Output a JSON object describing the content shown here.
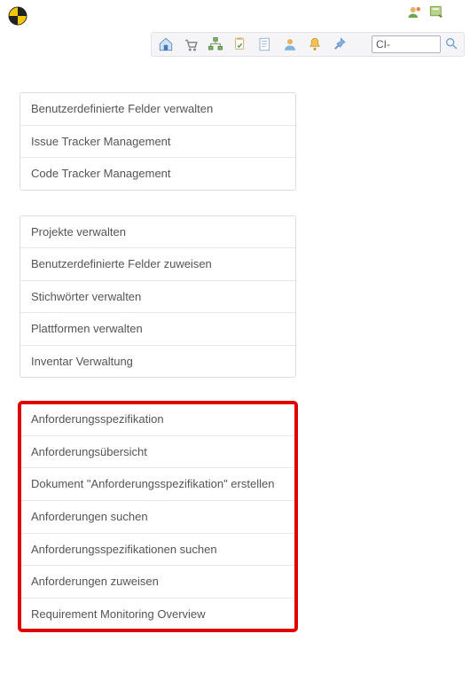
{
  "toolbar": {
    "search_value": "CI-",
    "icons": {
      "home": "home-icon",
      "cart": "cart-icon",
      "tree": "tree-icon",
      "plan": "plan-icon",
      "report": "report-icon",
      "user": "user-icon",
      "bell": "bell-icon",
      "pin": "pin-icon",
      "search": "search-icon"
    },
    "header_icons": {
      "users": "users-icon",
      "window": "window-icon"
    }
  },
  "panel_admin": {
    "items": [
      "Benutzerdefinierte Felder verwalten",
      "Issue Tracker Management",
      "Code Tracker Management"
    ]
  },
  "panel_project": {
    "items": [
      "Projekte verwalten",
      "Benutzerdefinierte Felder zuweisen",
      "Stichwörter verwalten",
      "Plattformen verwalten",
      "Inventar Verwaltung"
    ]
  },
  "panel_requirements": {
    "items": [
      "Anforderungsspezifikation",
      "Anforderungsübersicht",
      "Dokument \"Anforderungsspezifikation\" erstellen",
      "Anforderungen suchen",
      "Anforderungsspezifikationen suchen",
      "Anforderungen zuweisen",
      "Requirement Monitoring Overview"
    ]
  }
}
